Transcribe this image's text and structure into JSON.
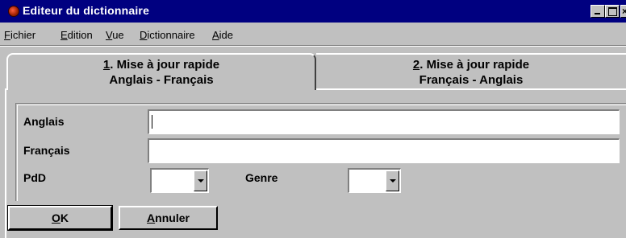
{
  "window": {
    "title": "Editeur du dictionnaire"
  },
  "menu": {
    "items": [
      {
        "mnemonic": "F",
        "rest": "ichier"
      },
      {
        "mnemonic": "E",
        "rest": "dition"
      },
      {
        "mnemonic": "V",
        "rest": "ue"
      },
      {
        "mnemonic": "D",
        "rest": "ictionnaire"
      },
      {
        "mnemonic": "A",
        "rest": "ide"
      }
    ]
  },
  "tabs": [
    {
      "number": "1",
      "line1_rest": ". Mise à jour rapide",
      "line2": "Anglais - Français",
      "active": true
    },
    {
      "number": "2",
      "line1_rest": ". Mise à jour rapide",
      "line2": "Français - Anglais",
      "active": false
    }
  ],
  "form": {
    "anglais_label": "Anglais",
    "anglais_value": "",
    "francais_label": "Français",
    "francais_value": "",
    "pdd_label": "PdD",
    "pdd_value": "",
    "genre_label": "Genre",
    "genre_value": ""
  },
  "buttons": {
    "ok_mnemonic": "O",
    "ok_rest": "K",
    "cancel_mnemonic": "A",
    "cancel_rest": "nnuler"
  },
  "colors": {
    "titlebar": "#000080",
    "face": "#c0c0c0"
  },
  "icons": {
    "title": "app-icon",
    "minimize": "minimize-icon",
    "maximize": "maximize-icon",
    "close": "close-icon"
  }
}
